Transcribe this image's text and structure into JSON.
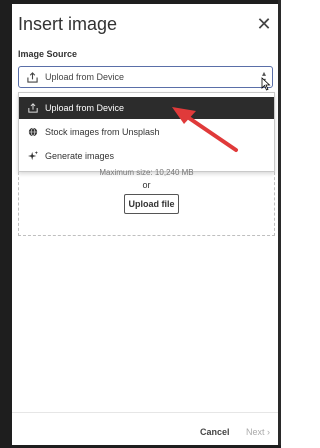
{
  "dialog": {
    "title": "Insert image",
    "close_glyph": "✕"
  },
  "image_source": {
    "label": "Image Source",
    "selected": "Upload from Device",
    "caret_up": "▴",
    "caret_down": "▾"
  },
  "dropdown": {
    "options": [
      {
        "label": "Upload from Device",
        "icon": "upload-icon",
        "selected": true
      },
      {
        "label": "Stock images from Unsplash",
        "icon": "globe-icon",
        "selected": false
      },
      {
        "label": "Generate images",
        "icon": "sparkle-icon",
        "selected": false
      }
    ]
  },
  "dropzone": {
    "max_size": "Maximum size: 10,240 MB",
    "or_text": "or",
    "upload_button": "Upload file"
  },
  "footer": {
    "cancel": "Cancel",
    "next": "Next ›"
  },
  "colors": {
    "arrow": "#e03a3a",
    "selected_bg": "#2c2c2c",
    "select_border": "#5a6fa8"
  }
}
